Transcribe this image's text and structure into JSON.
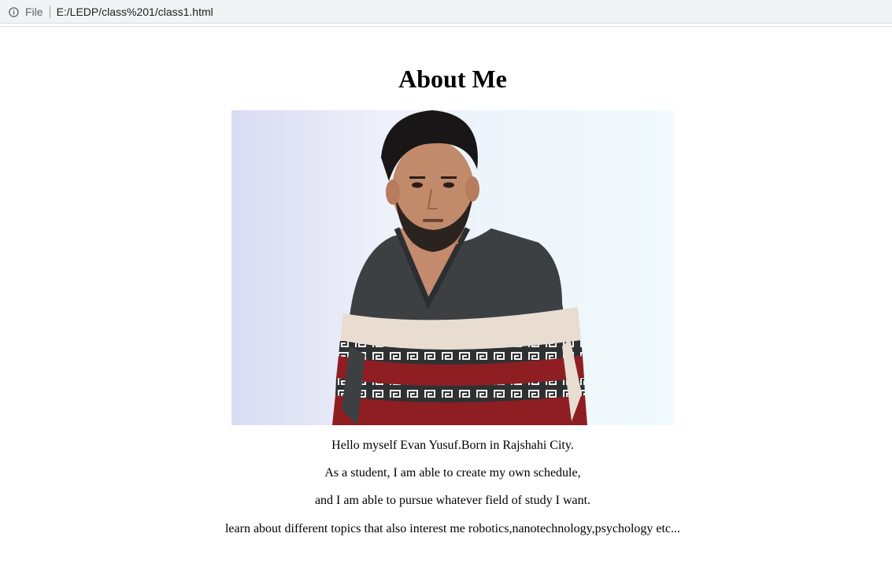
{
  "browser": {
    "file_label": "File",
    "url": "E:/LEDP/class%201/class1.html",
    "info_icon": "info-icon"
  },
  "page": {
    "heading": "About Me",
    "photo_alt": "Portrait photo",
    "paragraphs": [
      "Hello myself Evan Yusuf.Born in Rajshahi City.",
      "As a student, I am able to create my own schedule,",
      "and I am able to pursue whatever field of study I want.",
      "learn about different topics that also interest me robotics,nanotechnology,psychology etc..."
    ]
  },
  "colors": {
    "sweater_dark": "#3d4042",
    "sweater_red": "#8e1e22",
    "sweater_cream": "#e9ddd2",
    "background_light": "#e4ecf6"
  }
}
